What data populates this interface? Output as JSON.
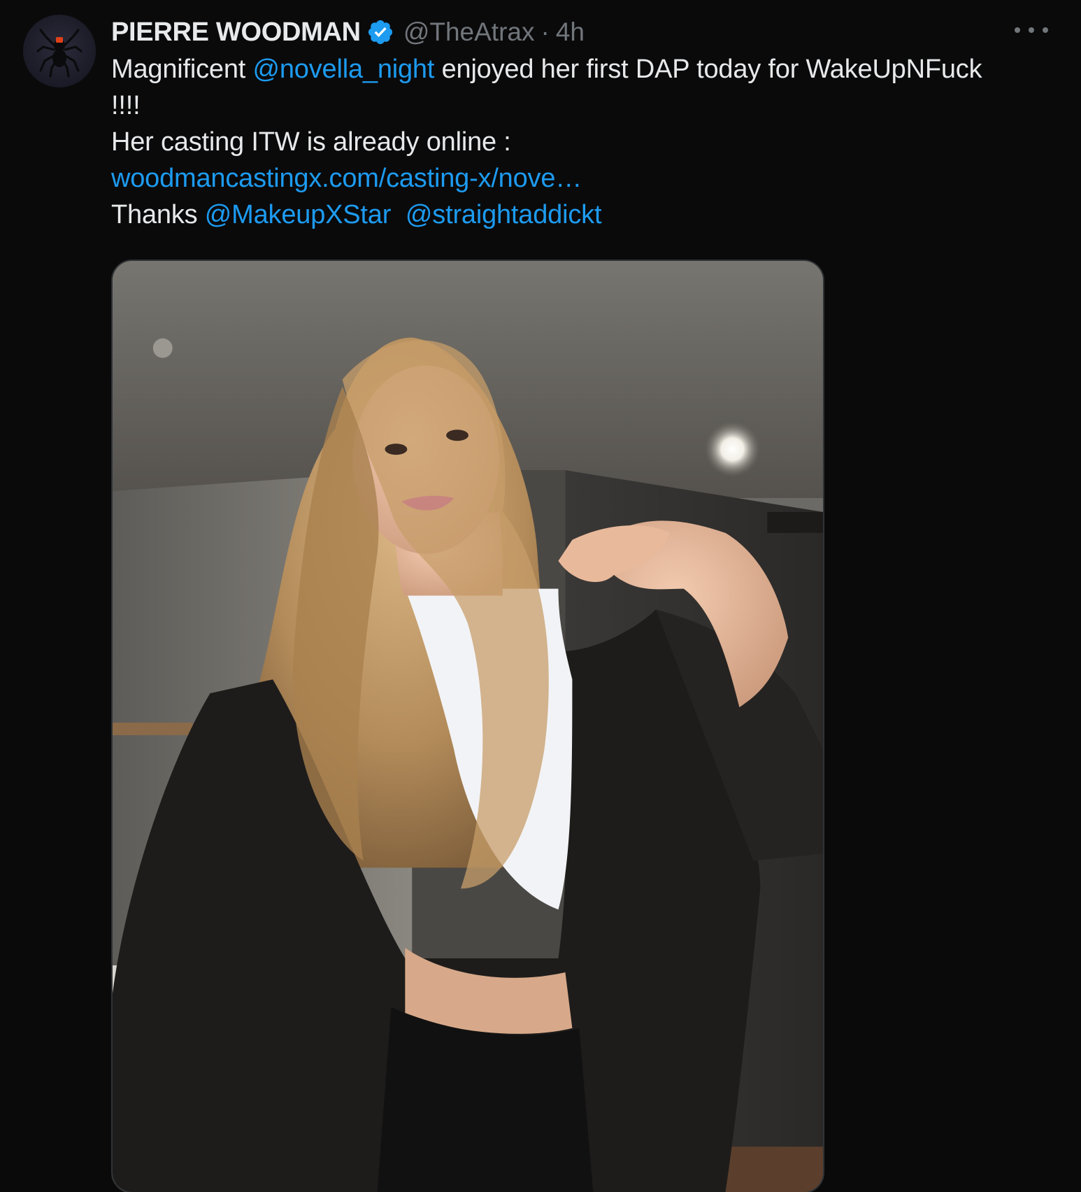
{
  "tweet": {
    "author_name": "PIERRE WOODMAN",
    "handle": "@TheAtrax",
    "separator": "·",
    "time": "4h",
    "avatar_icon": "spider-logo-icon",
    "verified_icon": "verified-badge-icon",
    "more_icon": "more-options-icon",
    "text": {
      "line1_prefix": "Magnificent ",
      "mention1": "@novella_night",
      "line1_suffix": " enjoyed her first DAP today for WakeUpNFuck",
      "line2": "!!!!",
      "line3": "Her casting ITW is already online :",
      "link": "woodmancastingx.com/casting-x/nove…",
      "line5_prefix": "Thanks ",
      "mention2": "@MakeupXStar",
      "mention3": "@straightaddickt"
    },
    "media": {
      "type": "photo"
    }
  },
  "colors": {
    "background": "#0a0a0b",
    "text": "#e7e9ea",
    "secondary": "#71767b",
    "link": "#1d9bf0",
    "verified": "#1d9bf0"
  }
}
